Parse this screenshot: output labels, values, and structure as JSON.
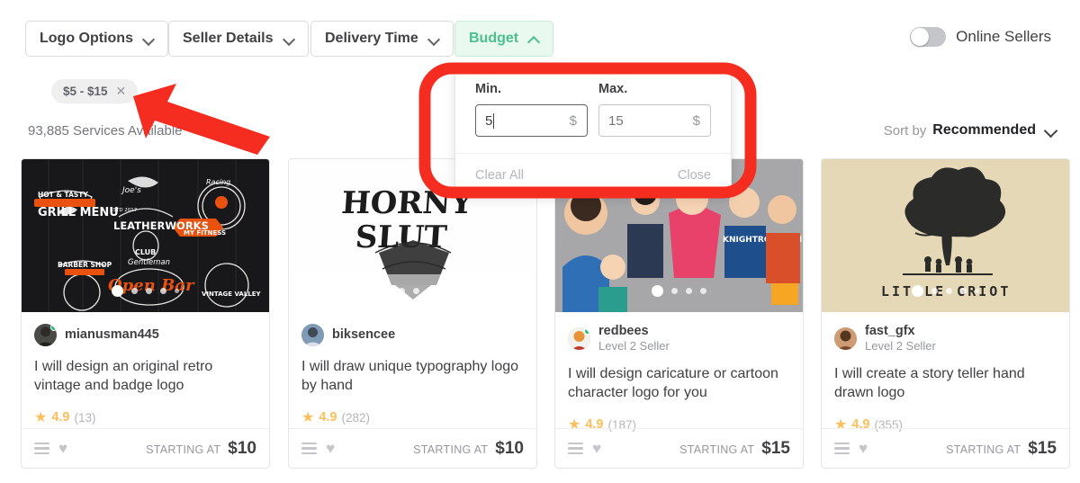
{
  "filters": {
    "buttons": [
      {
        "label": "Logo Options",
        "icon": "chevron-down-icon",
        "active": false
      },
      {
        "label": "Seller Details",
        "icon": "chevron-down-icon",
        "active": false
      },
      {
        "label": "Delivery Time",
        "icon": "chevron-down-icon",
        "active": false
      },
      {
        "label": "Budget",
        "icon": "chevron-up-icon",
        "active": true
      }
    ],
    "online_toggle": {
      "label": "Online Sellers",
      "state": "off"
    },
    "applied_chip": {
      "label": "$5 - $15",
      "remove_icon": "close-icon"
    },
    "results_count": "93,885 Services Available",
    "sort": {
      "prefix": "Sort by",
      "value": "Recommended",
      "icon": "chevron-down-icon"
    }
  },
  "budget_dropdown": {
    "min": {
      "label": "Min.",
      "value": "5",
      "currency": "$",
      "focused": true
    },
    "max": {
      "label": "Max.",
      "value": "15",
      "currency": "$",
      "focused": false
    },
    "clear_label": "Clear All",
    "close_label": "Close"
  },
  "annotations": {
    "highlight_color": "#f52d20",
    "arrow": "red-arrow-annotation",
    "box": "red-rectangle-annotation"
  },
  "colors": {
    "brand_green": "#4cc08c",
    "budget_bg": "#e9f9f0",
    "star": "#ffbe5b",
    "online": "#1dbf73"
  },
  "cards": [
    {
      "seller": "mianusman445",
      "level": "",
      "online": true,
      "title": "I will design an original retro vintage and badge logo",
      "rating": "4.9",
      "reviews": "(13)",
      "starting_label": "STARTING AT",
      "price": "$10",
      "dots": 5,
      "thumb_kind": "dark-badge-collage"
    },
    {
      "seller": "biksencee",
      "level": "",
      "online": false,
      "title": "I will draw unique typography logo by hand",
      "rating": "4.9",
      "reviews": "(282)",
      "starting_label": "STARTING AT",
      "price": "$10",
      "dots": 5,
      "thumb_kind": "white-typography"
    },
    {
      "seller": "redbees",
      "level": "Level 2 Seller",
      "online": true,
      "title": "I will design caricature or cartoon character logo for you",
      "rating": "4.9",
      "reviews": "(187)",
      "starting_label": "STARTING AT",
      "price": "$15",
      "dots": 4,
      "thumb_kind": "caricature-collage"
    },
    {
      "seller": "fast_gfx",
      "level": "Level 2 Seller",
      "online": false,
      "title": "I will create a story teller hand drawn logo",
      "rating": "4.9",
      "reviews": "(355)",
      "starting_label": "STARTING AT",
      "price": "$15",
      "dots": 5,
      "thumb_kind": "little-griot-tree"
    }
  ],
  "thumb_text": {
    "card0": [
      "HOT & TASTY",
      "GRILL MENU",
      "Joe's",
      "LEATHERWORKS",
      "Racing",
      "BARBER SHOP",
      "CLUB",
      "Gentleman",
      "MY FITNESS",
      "Open Bar",
      "VINTAGE VALLEY"
    ],
    "card1": [
      "HORNY",
      "SLUT"
    ],
    "card3": [
      "LITTLE GRIOT"
    ]
  }
}
